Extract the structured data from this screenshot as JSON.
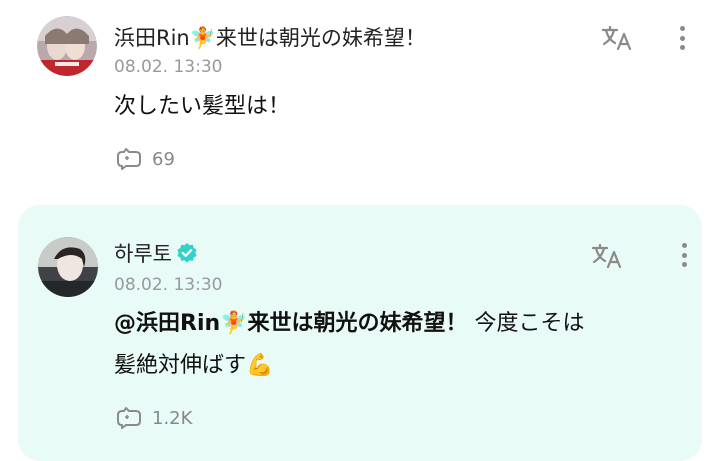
{
  "comments": [
    {
      "author": "浜田Rin🧚来世は朝光の妹希望！",
      "timestamp": "08.02. 13:30",
      "text": "次したい髪型は！",
      "reaction_count": "69",
      "icons": {
        "translate": "translate-icon",
        "more": "more-vertical-icon",
        "reaction": "reaction-icon"
      }
    },
    {
      "author": "하루토",
      "verified": true,
      "timestamp": "08.02. 13:30",
      "mention": "@浜田Rin🧚来世は朝光の妹希望！",
      "text_line1_rest": " 今度こそは",
      "text_line2": "髪絶対伸ばす💪",
      "reaction_count": "1.2K",
      "icons": {
        "translate": "translate-icon",
        "more": "more-vertical-icon",
        "reaction": "reaction-icon",
        "verified": "verified-badge-icon"
      },
      "colors": {
        "highlight_background": "#e9fbf6",
        "verified_badge": "#35d0c8"
      }
    }
  ]
}
